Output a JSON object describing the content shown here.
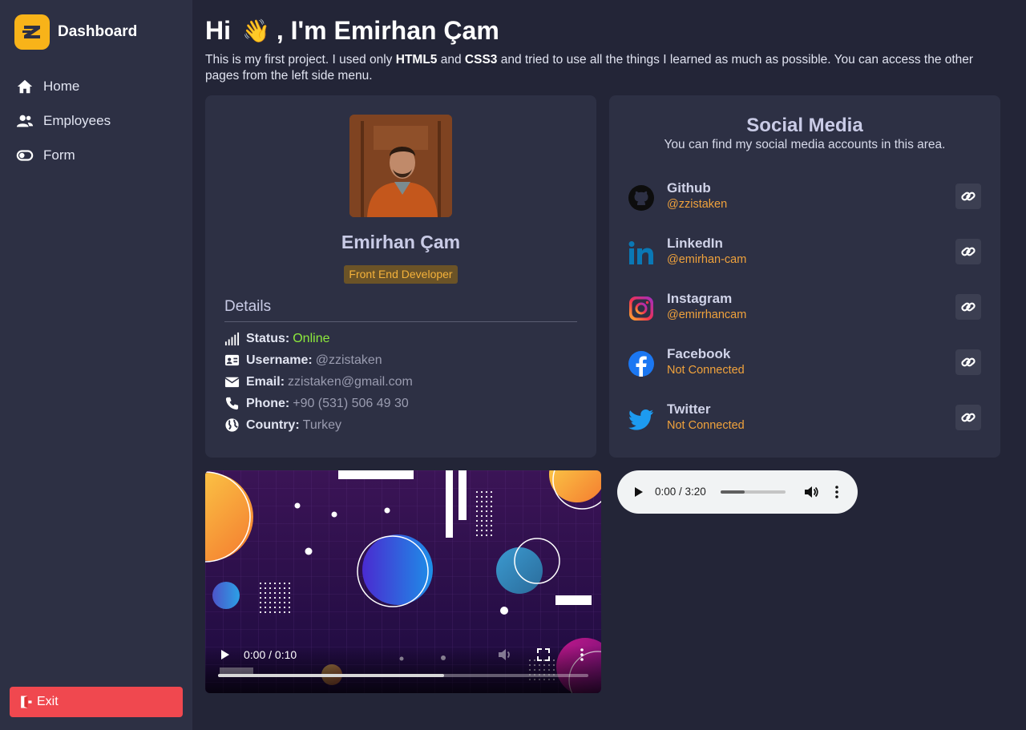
{
  "brand": {
    "title": "Dashboard",
    "logo_letter": "Z",
    "logo_color": "#f8b319"
  },
  "nav": [
    {
      "label": "Home",
      "icon": "home-icon"
    },
    {
      "label": "Employees",
      "icon": "users-icon"
    },
    {
      "label": "Form",
      "icon": "toggle-icon"
    }
  ],
  "exit": {
    "label": "Exit",
    "icon": "door-exit-icon",
    "color": "#f0484f"
  },
  "header": {
    "greeting_start": "Hi",
    "wave": "👋",
    "greeting_end": ", I'm Emirhan Çam",
    "intro_1": "This is my first project. I used only ",
    "intro_html5": "HTML5",
    "intro_2": " and ",
    "intro_css3": "CSS3",
    "intro_3": " and tried to use all the things I learned as much as possible. You can access the other pages from the left side menu."
  },
  "profile": {
    "name": "Emirhan Çam",
    "role": "Front End Developer",
    "details_title": "Details",
    "details": [
      {
        "label": "Status:",
        "value": "Online",
        "icon": "signal-icon",
        "status_color": "#8dea3c"
      },
      {
        "label": "Username:",
        "value": "@zzistaken",
        "icon": "id-card-icon"
      },
      {
        "label": "Email:",
        "value": "zzistaken@gmail.com",
        "icon": "envelope-icon"
      },
      {
        "label": "Phone:",
        "value": "+90 (531) 506 49 30",
        "icon": "phone-icon"
      },
      {
        "label": "Country:",
        "value": "Turkey",
        "icon": "globe-icon"
      }
    ]
  },
  "social": {
    "title": "Social Media",
    "subtitle": "You can find my social media accounts in this area.",
    "items": [
      {
        "name": "Github",
        "handle": "@zzistaken",
        "icon": "github-icon"
      },
      {
        "name": "LinkedIn",
        "handle": "@emirhan-cam",
        "icon": "linkedin-icon"
      },
      {
        "name": "Instagram",
        "handle": "@emirrhancam",
        "icon": "instagram-icon"
      },
      {
        "name": "Facebook",
        "handle": "Not Connected",
        "icon": "facebook-icon"
      },
      {
        "name": "Twitter",
        "handle": "Not Connected",
        "icon": "twitter-icon"
      }
    ]
  },
  "video": {
    "time": "0:00 / 0:10",
    "progress": 0.61
  },
  "audio": {
    "time": "0:00 / 3:20",
    "progress": 0.37
  }
}
